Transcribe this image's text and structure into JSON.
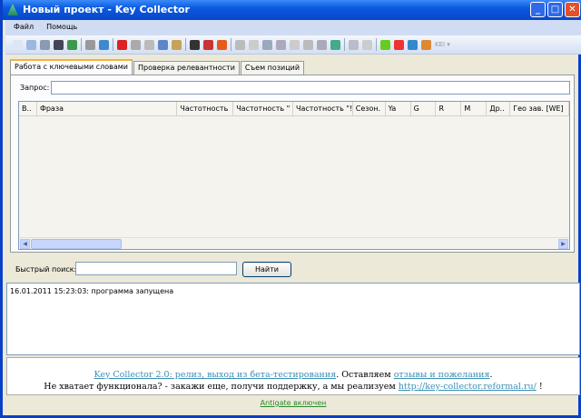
{
  "window": {
    "title": "Новый проект - Key Collector",
    "minimize": "_",
    "maximize": "□",
    "close": "✕"
  },
  "menu": [
    "Файл",
    "Помощь"
  ],
  "toolbar": {
    "icons": [
      "new-icon",
      "open-icon",
      "save-icon",
      "save-as-icon",
      "excel-icon",
      "settings-icon",
      "globe-icon",
      "chart-red-icon",
      "chart-gray-icon",
      "disk-icon",
      "shield-icon",
      "clipboard-icon",
      "filter-icon",
      "target-icon",
      "puzzle-icon",
      "zoom-icon",
      "doc-icon",
      "li-icon",
      "liveinternet-icon",
      "dollar-icon",
      "hand-icon",
      "mi-icon",
      "table-icon",
      "a-icon",
      "pen-icon",
      "arrow-icon",
      "yandex-icon",
      "google-icon",
      "rambler-icon"
    ],
    "kei_label": "KEI"
  },
  "tabs": [
    "Работа с ключевыми словами",
    "Проверка релевантности",
    "Съем позиций"
  ],
  "query": {
    "label": "Запрос:",
    "value": ""
  },
  "grid": {
    "columns": [
      "В..",
      "Фраза",
      "Частотность",
      "Частотность \" \"",
      "Частотность \"!\"",
      "Сезон.",
      "Ya",
      "G",
      "R",
      "M",
      "Др..",
      "Гео зав. [WE]"
    ]
  },
  "quick_search": {
    "label": "Быстрый поиск:",
    "value": "",
    "button": "Найти"
  },
  "log": [
    "16.01.2011 15:23:03: программа запущена"
  ],
  "info": {
    "link1": "Key Collector 2.0: релиз, выход из бета-тестирования",
    "text1": ". Оставляем ",
    "link2": "отзывы и пожелания",
    "text2": ".",
    "text3": "Не хватает функционала? - закажи еще, получи поддержку, а мы реализуем ",
    "link3": "http://key-collector.reformal.ru/",
    "text4": " !"
  },
  "status": "Antigate включен"
}
